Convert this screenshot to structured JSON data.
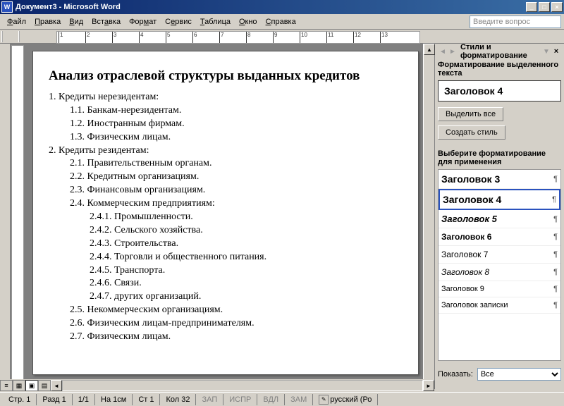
{
  "titlebar": {
    "title": "Документ3 - Microsoft Word"
  },
  "menu": {
    "file": "Файл",
    "edit": "Правка",
    "view": "Вид",
    "insert": "Вставка",
    "format": "Формат",
    "tools": "Сервис",
    "table": "Таблица",
    "window": "Окно",
    "help": "Справка"
  },
  "help_placeholder": "Введите вопрос",
  "ruler_marks": [
    "1",
    "2",
    "3",
    "4",
    "5",
    "6",
    "7",
    "8",
    "9",
    "10",
    "11",
    "12",
    "13"
  ],
  "document": {
    "title": "Анализ отраслевой структуры выданных кредитов",
    "lines": [
      {
        "cls": "lvl1",
        "t": "1.    Кредиты нерезидентам:"
      },
      {
        "cls": "lvl2",
        "t": "1.1.   Банкам-нерезидентам."
      },
      {
        "cls": "lvl2",
        "t": "1.2.   Иностранным фирмам."
      },
      {
        "cls": "lvl2",
        "t": "1.3.   Физическим лицам."
      },
      {
        "cls": "lvl1",
        "t": "2.    Кредиты резидентам:"
      },
      {
        "cls": "lvl2",
        "t": "2.1.   Правительственным органам."
      },
      {
        "cls": "lvl2",
        "t": "2.2.   Кредитным организациям."
      },
      {
        "cls": "lvl2",
        "t": "2.3.   Финансовым организациям."
      },
      {
        "cls": "lvl2",
        "t": "2.4.   Коммерческим предприятиям:"
      },
      {
        "cls": "lvl3",
        "t": "2.4.1. Промышленности."
      },
      {
        "cls": "lvl3",
        "t": "2.4.2. Сельского хозяйства."
      },
      {
        "cls": "lvl3",
        "t": "2.4.3. Строительства."
      },
      {
        "cls": "lvl3",
        "t": "2.4.4. Торговли и общественного питания."
      },
      {
        "cls": "lvl3",
        "t": "2.4.5. Транспорта."
      },
      {
        "cls": "lvl3",
        "t": "2.4.6. Связи."
      },
      {
        "cls": "lvl3",
        "t": "2.4.7. других организаций."
      },
      {
        "cls": "lvl2",
        "t": "2.5.   Некоммерческим организациям."
      },
      {
        "cls": "lvl2",
        "t": "2.6.   Физическим лицам-предпринимателям."
      },
      {
        "cls": "lvl2",
        "t": "2.7.   Физическим лицам."
      }
    ]
  },
  "taskpane": {
    "title": "Стили и форматирование",
    "section1": "Форматирование выделенного текста",
    "current_style": "Заголовок 4",
    "select_all": "Выделить все",
    "new_style": "Создать стиль",
    "section2": "Выберите форматирование для применения",
    "styles": [
      {
        "name": "Заголовок 3",
        "bold": true,
        "italic": false,
        "sel": false,
        "size": "14px"
      },
      {
        "name": "Заголовок 4",
        "bold": true,
        "italic": false,
        "sel": true,
        "size": "14px"
      },
      {
        "name": "Заголовок 5",
        "bold": true,
        "italic": true,
        "sel": false,
        "size": "13px"
      },
      {
        "name": "Заголовок 6",
        "bold": true,
        "italic": false,
        "sel": false,
        "size": "12px"
      },
      {
        "name": "Заголовок 7",
        "bold": false,
        "italic": false,
        "sel": false,
        "size": "12px"
      },
      {
        "name": "Заголовок 8",
        "bold": false,
        "italic": true,
        "sel": false,
        "size": "12px"
      },
      {
        "name": "Заголовок 9",
        "bold": false,
        "italic": false,
        "sel": false,
        "size": "11px"
      },
      {
        "name": "Заголовок записки",
        "bold": false,
        "italic": false,
        "sel": false,
        "size": "11px"
      }
    ],
    "show_label": "Показать:",
    "show_value": "Все"
  },
  "statusbar": {
    "page": "Стр. 1",
    "section": "Разд 1",
    "pages": "1/1",
    "at": "На 1см",
    "line": "Ст 1",
    "col": "Кол 32",
    "rec": "ЗАП",
    "trk": "ИСПР",
    "ext": "ВДЛ",
    "ovr": "ЗАМ",
    "lang": "русский (Ро"
  }
}
